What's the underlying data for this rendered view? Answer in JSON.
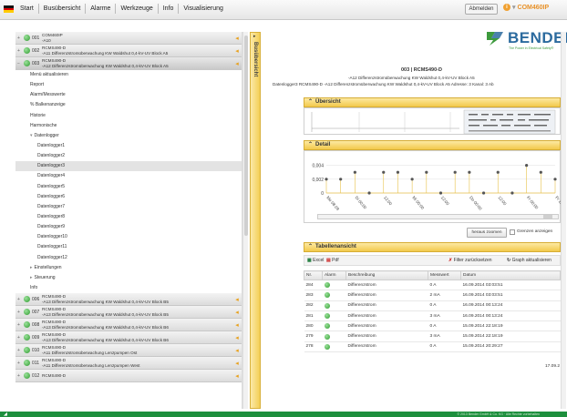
{
  "menu": {
    "items": [
      "Start",
      "Busübersicht",
      "Alarme",
      "Werkzeuge",
      "Info",
      "Visualisierung"
    ],
    "logout_label": "Abmelden",
    "device_name": "COM460IP"
  },
  "tree": {
    "devices_top": [
      {
        "num": "001",
        "line1": "COM460IP",
        "line2": "-A10"
      },
      {
        "num": "002",
        "line1": "RCMS490-D",
        "line2": "-A11 Differenzstromüberwachung KW Waldshut 0,4-kV-UV Block A5"
      },
      {
        "num": "003",
        "line1": "RCMS490-D",
        "line2": "-A12 Differenzstromüberwachung KW Waldshut 0,4-kV-UV Block A5"
      }
    ],
    "menu_items": [
      "Menü aktualisieren",
      "Report",
      "Alarm/Messwerte",
      "% Balkenanzeige",
      "Historie",
      "Harmonische"
    ],
    "datalogger_label": "Datenlogger",
    "dataloggers": [
      "Datenlogger1",
      "Datenlogger2",
      "Datenlogger3",
      "Datenlogger4",
      "Datenlogger5",
      "Datenlogger6",
      "Datenlogger7",
      "Datenlogger8",
      "Datenlogger9",
      "Datenlogger10",
      "Datenlogger11",
      "Datenlogger12"
    ],
    "after_items": [
      "Einstellungen",
      "Steuerung",
      "Info"
    ],
    "devices_bottom": [
      {
        "num": "006",
        "line1": "RCMS490-D",
        "line2": "-A13 Differenzstromüberwachung KW Waldshut 0,4-kV-UV Block B5"
      },
      {
        "num": "007",
        "line1": "RCMS490-D",
        "line2": "-A13 Differenzstromüberwachung KW Waldshut 0,4-kV-UV Block B5"
      },
      {
        "num": "008",
        "line1": "RCMS490-D",
        "line2": "-A13 Differenzstromüberwachung KW Waldshut 0,4-kV-UV Block B6"
      },
      {
        "num": "009",
        "line1": "RCMS490-D",
        "line2": "-A13 Differenzstromüberwachung KW Waldshut 0,4-kV-UV Block B6"
      },
      {
        "num": "010",
        "line1": "RCMS490-D",
        "line2": "-A11 Differenzstromüberwachung Lenzpumpen Ost"
      },
      {
        "num": "011",
        "line1": "RCMS490-D",
        "line2": "-A11 Differenzstromüberwachung Lenzpumpen West"
      },
      {
        "num": "012",
        "line1": "RCMS490-D",
        "line2": ""
      }
    ]
  },
  "vtab_label": "Busübersicht",
  "logo": {
    "name": "BENDER",
    "slogan": "The Power in Electrical Safety®"
  },
  "device": {
    "title": "003 | RCMS490-D",
    "subtitle": "-A12 Differenzstromüberwachung KW Waldshut 0,4-kV-UV Block A5",
    "line": "Datenlogger3  RCMS490-D  -A12 Differenzstromüberwachung KW Waldshut 0,4-kV-UV Block A5  Adresse: 3  Kanal: 3  Ab"
  },
  "panels": {
    "overview": "Übersicht",
    "detail": "Detail",
    "table": "Tabellenansicht"
  },
  "chart_data": {
    "type": "scatter",
    "y_ticks": [
      "0,004",
      "0,002",
      "0"
    ],
    "x_labels": [
      "Mo 08.09",
      "Di 00:00",
      "12:00",
      "Mi 00:00",
      "12:00",
      "Do 00:00",
      "12:00",
      "Fr 00:00",
      "Fr 12:00"
    ],
    "x": [
      0.0,
      0.5,
      1.0,
      1.5,
      2.0,
      2.5,
      3.0,
      3.5,
      4.0,
      4.5,
      5.0,
      5.5,
      6.0,
      6.5,
      7.0,
      7.5,
      8.0
    ],
    "values": [
      0.002,
      0.002,
      0.003,
      0.0,
      0.003,
      0.003,
      0.002,
      0.003,
      0.0,
      0.003,
      0.003,
      0.0,
      0.003,
      0.0,
      0.004,
      0.003,
      0.002
    ],
    "ylim": [
      0,
      0.005
    ]
  },
  "detail_controls": {
    "zoom_label": "heraus zoomen",
    "limits_label": "Grenzen anzeigen"
  },
  "table_toolbar": {
    "excel": "Excel",
    "pdf": "Pdf",
    "reset_filter": "Filter zurücksetzen",
    "refresh_graph": "Graph aktualisieren"
  },
  "table": {
    "headers": [
      "Nr.",
      "Alarm",
      "Beschreibung",
      "Messwert",
      "Datum"
    ],
    "rows": [
      {
        "nr": "284",
        "desc": "Differenzstrom",
        "val": "0 A",
        "date": "16.09.2014 03:03:51"
      },
      {
        "nr": "283",
        "desc": "Differenzstrom",
        "val": "2 mA",
        "date": "16.09.2014 03:03:51"
      },
      {
        "nr": "282",
        "desc": "Differenzstrom",
        "val": "0 A",
        "date": "16.09.2014 00:13:24"
      },
      {
        "nr": "281",
        "desc": "Differenzstrom",
        "val": "3 mA",
        "date": "16.09.2014 00:13:24"
      },
      {
        "nr": "280",
        "desc": "Differenzstrom",
        "val": "0 A",
        "date": "15.09.2014 22:18:19"
      },
      {
        "nr": "279",
        "desc": "Differenzstrom",
        "val": "3 mA",
        "date": "15.09.2014 22:18:19"
      },
      {
        "nr": "278",
        "desc": "Differenzstrom",
        "val": "0 A",
        "date": "15.09.2014 20:29:27"
      }
    ]
  },
  "footer_date": "17.09.2",
  "copyright": "© 2013 Bender GmbH & Co. KG · Alle Rechte vorbehalten",
  "colors": {
    "accent": "#f2c94b",
    "brand": "#2b6a9e",
    "ok": "#2f9a2f",
    "footer": "#1d8f3d"
  }
}
